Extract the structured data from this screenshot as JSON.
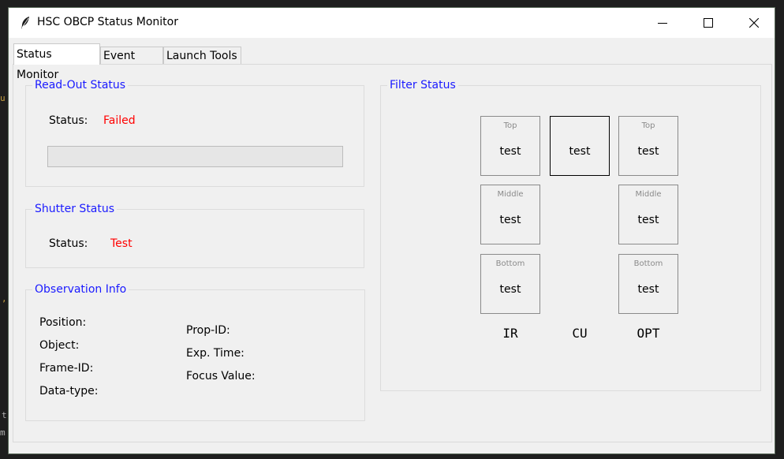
{
  "window": {
    "title": "HSC OBCP Status Monitor",
    "minimize_glyph": "—",
    "close_glyph": "✕"
  },
  "tabs": [
    {
      "label": "Status Monitor",
      "active": true
    },
    {
      "label": "Event Logs",
      "active": false
    },
    {
      "label": "Launch Tools",
      "active": false
    }
  ],
  "readout": {
    "title": "Read-Out Status",
    "status_label": "Status:",
    "status_value": "Failed",
    "progress": 0
  },
  "shutter": {
    "title": "Shutter Status",
    "status_label": "Status:",
    "status_value": "Test"
  },
  "observation": {
    "title": "Observation Info",
    "left_fields": [
      "Position:",
      "Object:",
      "Frame-ID:",
      "Data-type:"
    ],
    "right_fields": [
      "Prop-ID:",
      "Exp. Time:",
      "Focus Value:"
    ]
  },
  "filter": {
    "title": "Filter Status",
    "ir": {
      "top": {
        "pos": "Top",
        "value": "test"
      },
      "middle": {
        "pos": "Middle",
        "value": "test"
      },
      "bottom": {
        "pos": "Bottom",
        "value": "test"
      }
    },
    "cu": {
      "value": "test"
    },
    "opt": {
      "top": {
        "pos": "Top",
        "value": "test"
      },
      "middle": {
        "pos": "Middle",
        "value": "test"
      },
      "bottom": {
        "pos": "Bottom",
        "value": "test"
      }
    },
    "column_labels": [
      "IR",
      "CU",
      "OPT"
    ]
  },
  "colors": {
    "frame_title": "#1a1aff",
    "status_error": "#ff0000"
  },
  "icons": {
    "app": "feather-icon",
    "minimize": "minimize-icon",
    "maximize": "maximize-icon",
    "close": "close-icon"
  }
}
